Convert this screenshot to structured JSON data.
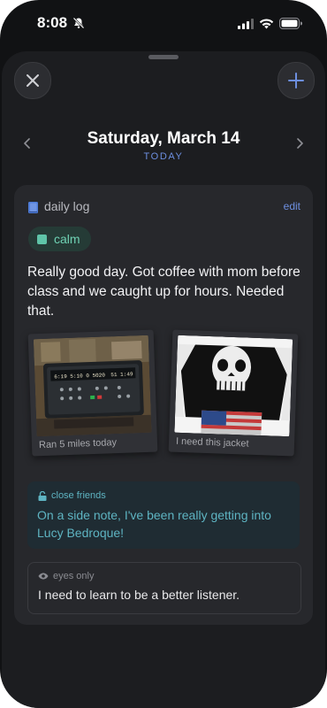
{
  "status_bar": {
    "time": "8:08"
  },
  "header": {
    "date": "Saturday, March 14",
    "subtitle": "TODAY"
  },
  "entry": {
    "title": "daily log",
    "edit_label": "edit",
    "mood": "calm",
    "text": "Really good day. Got coffee with mom before class and we caught up for hours. Needed that.",
    "photos": [
      {
        "caption": "Ran 5 miles today"
      },
      {
        "caption": "I need this jacket"
      }
    ],
    "close_friends": {
      "label": "close friends",
      "text": "On a side note, I've been really getting into Lucy Bedroque!"
    },
    "eyes_only": {
      "label": "eyes only",
      "text": "I need to learn to be a better listener."
    }
  },
  "treadmill_display": {
    "line1": "6:19  5:10",
    "line2": "0  5020",
    "line3": "51  1:49"
  },
  "colors": {
    "accent": "#6d8fe0",
    "mood": "#5fc4a8",
    "close_friends": "#5eb4c2"
  }
}
